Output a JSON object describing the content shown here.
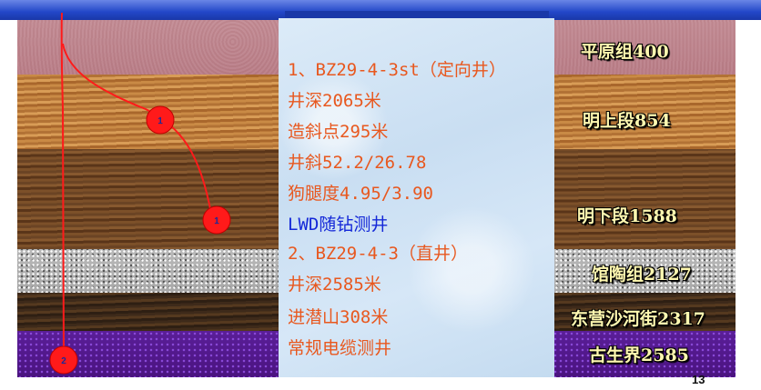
{
  "textbox": {
    "lines": [
      "1、BZ29-4-3st（定向井）",
      "井深2065米",
      "造斜点295米",
      "井斜52.2/26.78",
      "狗腿度4.95/3.90",
      "LWD随钻测井",
      "2、BZ29-4-3（直井）",
      "井深2585米",
      "进潜山308米",
      "常规电缆测井"
    ]
  },
  "formations": [
    "平原组400",
    "明上段854",
    "明下段1588",
    "馆陶组2127",
    "东营沙河街2317",
    "古生界2585"
  ],
  "markers": {
    "well1_upper": "1",
    "well1_lower": "1",
    "well2": "2"
  },
  "page_number": "13",
  "colors": {
    "body_text": "#e8581f",
    "highlight_text": "#1428d8",
    "label_text": "#fff8b0",
    "well_path": "#ff0000",
    "header_bar": "#2247c8"
  }
}
